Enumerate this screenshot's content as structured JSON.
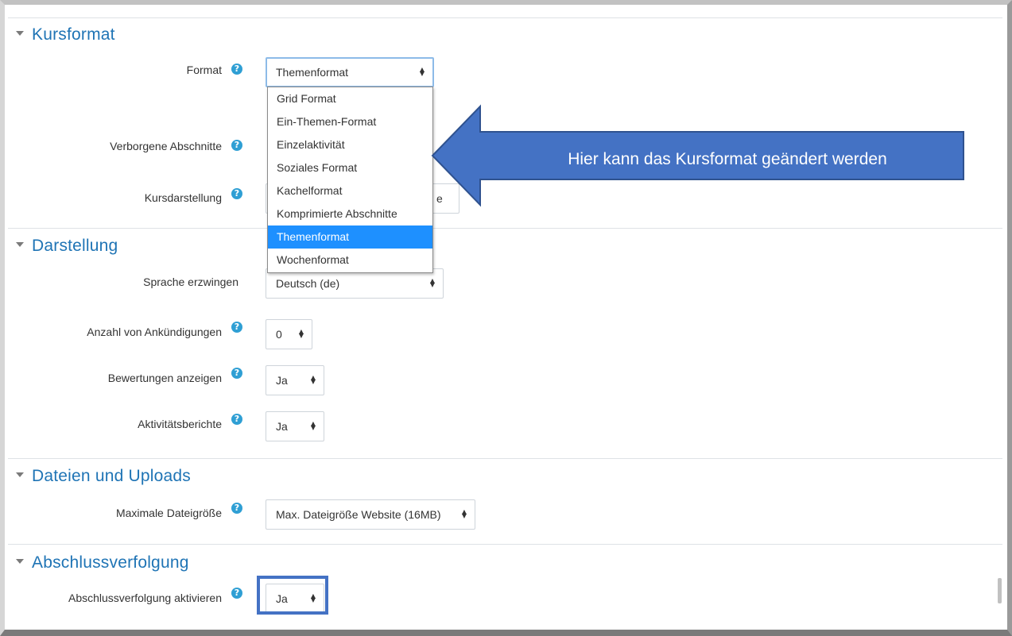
{
  "sections": {
    "kursformat": {
      "title": "Kursformat",
      "format_label": "Format",
      "format_value": "Themenformat",
      "hidden_sections_label": "Verborgene Abschnitte",
      "course_layout_label": "Kursdarstellung",
      "course_layout_value_partial": "e"
    },
    "darstellung": {
      "title": "Darstellung",
      "language_label": "Sprache erzwingen",
      "language_value": "Deutsch (de)",
      "announcements_label": "Anzahl von Ankündigungen",
      "announcements_value": "0",
      "grades_label": "Bewertungen anzeigen",
      "grades_value": "Ja",
      "reports_label": "Aktivitätsberichte",
      "reports_value": "Ja"
    },
    "dateien": {
      "title": "Dateien und Uploads",
      "max_size_label": "Maximale Dateigröße",
      "max_size_value": "Max. Dateigröße Website (16MB)"
    },
    "abschluss": {
      "title": "Abschlussverfolgung",
      "enable_label": "Abschlussverfolgung aktivieren",
      "enable_value": "Ja"
    }
  },
  "format_dropdown": {
    "options": [
      "Grid Format",
      "Ein-Themen-Format",
      "Einzelaktivität",
      "Soziales Format",
      "Kachelformat",
      "Komprimierte Abschnitte",
      "Themenformat",
      "Wochenformat"
    ],
    "selected": "Themenformat"
  },
  "callout": {
    "text": "Hier kann das Kursformat geändert werden",
    "color": "#4472c4"
  },
  "icons": {
    "help": "?",
    "select_arrows": "▲▼"
  },
  "colors": {
    "section_title": "#1f74b5",
    "help_icon": "#2f9fd4",
    "option_highlight": "#1e90ff",
    "highlight_box": "#4472c4"
  }
}
